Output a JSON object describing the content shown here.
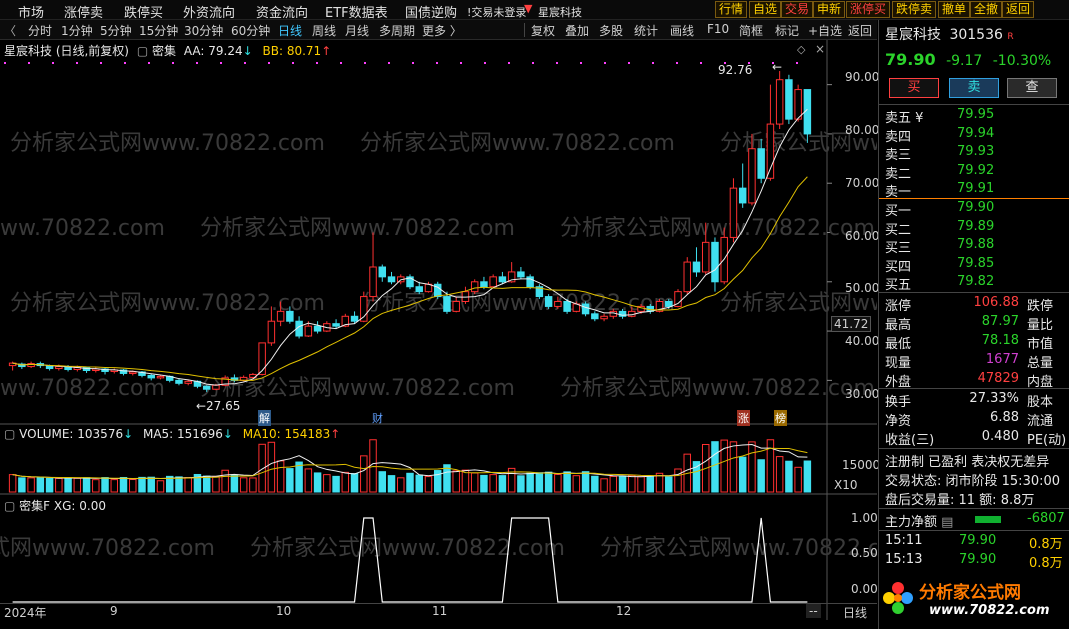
{
  "menu": {
    "items": [
      "市场",
      "涨停卖",
      "跌停买",
      "外资流向",
      "资金流向",
      "ETF数据表",
      "国债逆购"
    ],
    "status": "!交易未登录",
    "stock_dropdown": "星宸科技",
    "right_buttons": [
      "行情",
      "自选",
      "交易",
      "申新",
      "涨停买",
      "跌停卖",
      "撤单",
      "全撤",
      "返回"
    ],
    "colors": {
      "accent": "#ffd000",
      "trade": "#ff4040"
    }
  },
  "toolbar": {
    "menu_icon": "chevron-left-icon",
    "periods": [
      "分时",
      "1分钟",
      "5分钟",
      "15分钟",
      "30分钟",
      "60分钟",
      "日线",
      "周线",
      "月线",
      "多周期",
      "更多 〉"
    ],
    "active_period": "日线",
    "tools": [
      "复权",
      "叠加",
      "多股",
      "统计",
      "画线",
      "F10",
      "简框",
      "标记",
      "+自选",
      "返回"
    ]
  },
  "main_chart": {
    "title": "星宸科技 (日线,前复权)",
    "indicator_name": "密集",
    "aa": "AA: 79.24",
    "bb": "BB: 80.71",
    "high_label": "92.76",
    "low_label": "27.65",
    "price_tag": "41.72",
    "y_ticks": [
      "90.00",
      "80.00",
      "70.00",
      "60.00",
      "50.00",
      "40.00",
      "30.00"
    ],
    "markers": [
      "解",
      "财",
      "涨",
      "榜"
    ],
    "watermark": "分析家公式网www.70822.com"
  },
  "volume_panel": {
    "label": "VOLUME: 103576",
    "ma5": "MA5: 151696",
    "ma10": "MA10: 154183",
    "y_tick": "15000",
    "scale": "X10"
  },
  "xg_panel": {
    "label": "密集F XG: 0.00",
    "y_ticks": [
      "1.00",
      "0.50",
      "0.00"
    ]
  },
  "x_axis": {
    "labels": [
      "2024年",
      "9",
      "10",
      "11",
      "12"
    ],
    "end_button": "--",
    "end_label": "日线"
  },
  "quote": {
    "name": "星宸科技",
    "code": "301536",
    "badge": "R",
    "price": "79.90",
    "change": "-9.17",
    "change_pct": "-10.30%",
    "buttons": [
      "买",
      "卖",
      "查"
    ],
    "asks": [
      {
        "label": "卖五 ¥",
        "price": "79.95"
      },
      {
        "label": "卖四",
        "price": "79.94"
      },
      {
        "label": "卖三",
        "price": "79.93"
      },
      {
        "label": "卖二",
        "price": "79.92"
      },
      {
        "label": "卖一",
        "price": "79.91"
      }
    ],
    "bids": [
      {
        "label": "买一",
        "price": "79.90"
      },
      {
        "label": "买二",
        "price": "79.89"
      },
      {
        "label": "买三",
        "price": "79.88"
      },
      {
        "label": "买四",
        "price": "79.85"
      },
      {
        "label": "买五",
        "price": "79.82"
      }
    ],
    "stats": [
      {
        "k": "涨停",
        "v": "106.88",
        "k2": "跌停"
      },
      {
        "k": "最高",
        "v": "87.97",
        "k2": "量比"
      },
      {
        "k": "最低",
        "v": "78.18",
        "k2": "市值"
      },
      {
        "k": "现量",
        "v": "1677",
        "k2": "总量"
      },
      {
        "k": "外盘",
        "v": "47829",
        "k2": "内盘"
      }
    ],
    "stats2": [
      {
        "k": "换手",
        "v": "27.33%",
        "k2": "股本"
      },
      {
        "k": "净资",
        "v": "6.88",
        "k2": "流通"
      },
      {
        "k": "收益(三)",
        "v": "0.480",
        "k2": "PE(动)"
      }
    ],
    "info1": "注册制 已盈利 表决权无差异",
    "info2": "交易状态: 闭市阶段 15:30:00",
    "info3": "盘后交易量: 11  额: 8.8万",
    "main_flow_label": "主力净额",
    "main_flow_value": "-6807",
    "ticks": [
      {
        "time": "15:11",
        "price": "79.90",
        "amt": "0.8万"
      },
      {
        "time": "15:13",
        "price": "79.90",
        "amt": "0.8万"
      }
    ],
    "logo_text": "分析家公式网",
    "logo_url_text": "www.70822.com"
  },
  "chart_data": {
    "type": "candlestick",
    "ylim": [
      25,
      95
    ],
    "candles": [
      [
        33,
        33.5,
        32,
        33.8
      ],
      [
        33.3,
        32.8,
        32.3,
        33.6
      ],
      [
        32.8,
        33.4,
        32.5,
        33.8
      ],
      [
        33.4,
        33,
        32.5,
        33.8
      ],
      [
        33,
        32.4,
        32,
        33.2
      ],
      [
        32.4,
        32.8,
        32,
        33.2
      ],
      [
        32.8,
        32.2,
        31.8,
        33.1
      ],
      [
        32.2,
        32.6,
        31.8,
        33
      ],
      [
        32.6,
        32,
        31.5,
        32.8
      ],
      [
        32,
        32.3,
        31.6,
        32.6
      ],
      [
        32.3,
        31.8,
        31.2,
        32.5
      ],
      [
        31.8,
        32.1,
        31.4,
        32.4
      ],
      [
        32.1,
        31.4,
        31,
        32.3
      ],
      [
        31.4,
        31.7,
        31,
        32
      ],
      [
        31.7,
        31,
        30.6,
        31.9
      ],
      [
        31,
        30.5,
        30,
        31.3
      ],
      [
        30.5,
        30.8,
        30.2,
        31
      ],
      [
        30.8,
        30,
        29.6,
        31
      ],
      [
        30,
        29.4,
        29,
        30.3
      ],
      [
        29.4,
        29.8,
        29,
        30.2
      ],
      [
        29.8,
        28.8,
        28.4,
        30
      ],
      [
        28.8,
        28.2,
        27.65,
        29
      ],
      [
        28.2,
        29,
        28,
        29.3
      ],
      [
        29,
        30.5,
        28.8,
        31
      ],
      [
        30.5,
        30,
        29.6,
        31.2
      ],
      [
        30,
        30.6,
        29.8,
        31
      ],
      [
        30.6,
        31.2,
        30.3,
        31.5
      ],
      [
        31.2,
        37.6,
        31,
        37.6
      ],
      [
        37.6,
        42,
        37,
        45
      ],
      [
        42,
        44,
        41,
        46
      ],
      [
        44,
        42,
        41.5,
        45
      ],
      [
        42,
        39,
        38.5,
        43
      ],
      [
        39,
        41,
        38.8,
        42
      ],
      [
        41,
        40,
        39.5,
        42
      ],
      [
        40,
        41.5,
        39.8,
        42
      ],
      [
        41.5,
        41,
        40.5,
        42.4
      ],
      [
        41,
        43,
        40.8,
        43.5
      ],
      [
        43,
        42,
        41.5,
        44
      ],
      [
        42,
        47,
        41.8,
        48
      ],
      [
        47,
        53,
        46,
        60
      ],
      [
        53,
        51,
        50,
        53.5
      ],
      [
        51,
        50,
        49.5,
        52
      ],
      [
        50,
        51,
        49.5,
        51.5
      ],
      [
        51,
        49,
        48.5,
        51.5
      ],
      [
        49,
        48,
        47.5,
        50
      ],
      [
        48,
        49.5,
        47.8,
        50
      ],
      [
        49.5,
        47,
        46.5,
        50
      ],
      [
        47,
        44,
        43.5,
        48
      ],
      [
        44,
        46,
        43.8,
        47
      ],
      [
        46,
        48,
        45.5,
        49
      ],
      [
        48,
        50,
        47.5,
        50.5
      ],
      [
        50,
        49,
        48.5,
        51
      ],
      [
        49,
        51,
        48.8,
        51.5
      ],
      [
        51,
        50,
        49.5,
        52
      ],
      [
        50,
        52,
        49.8,
        54
      ],
      [
        52,
        51,
        50.5,
        53
      ],
      [
        51,
        49,
        48.5,
        51.5
      ],
      [
        49,
        47,
        46.5,
        49.5
      ],
      [
        47,
        45,
        44.5,
        47.5
      ],
      [
        45,
        46,
        44.5,
        47
      ],
      [
        46,
        44,
        43.5,
        46.5
      ],
      [
        44,
        45.5,
        43.8,
        46
      ],
      [
        45.5,
        43.5,
        43,
        46
      ],
      [
        43.5,
        42.5,
        42,
        44
      ],
      [
        42.5,
        43,
        42,
        43.5
      ],
      [
        43,
        44,
        42.5,
        44.5
      ],
      [
        44,
        43,
        42.5,
        44.5
      ],
      [
        43,
        44,
        42.8,
        45
      ],
      [
        44,
        45,
        43.5,
        45.5
      ],
      [
        45,
        44,
        43.5,
        45.5
      ],
      [
        44,
        46,
        43.8,
        46.5
      ],
      [
        46,
        45,
        44.5,
        46.5
      ],
      [
        45,
        48,
        44.8,
        48.5
      ],
      [
        48,
        54,
        47.5,
        55
      ],
      [
        54,
        52,
        51,
        57
      ],
      [
        52,
        58,
        51.5,
        62
      ],
      [
        58,
        50,
        48,
        59
      ],
      [
        50,
        59,
        49.5,
        61
      ],
      [
        59,
        69,
        58,
        71
      ],
      [
        69,
        66,
        65,
        74
      ],
      [
        66,
        77,
        65.5,
        80
      ],
      [
        77,
        71,
        70,
        79
      ],
      [
        71,
        82,
        70.5,
        90
      ],
      [
        82,
        91,
        81,
        92.76
      ],
      [
        91,
        83,
        82,
        92
      ],
      [
        83,
        89,
        82.5,
        90
      ],
      [
        89,
        80,
        78.18,
        87.97
      ]
    ],
    "volume_ylim": [
      0,
      30000
    ]
  }
}
